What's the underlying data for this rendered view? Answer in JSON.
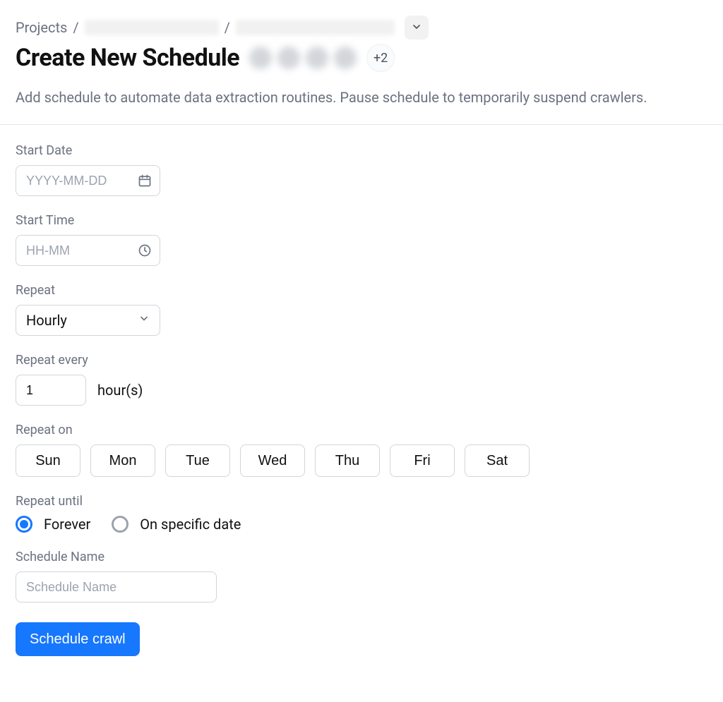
{
  "breadcrumb": {
    "root": "Projects",
    "sep": "/",
    "extra_badge": "+2"
  },
  "header": {
    "title": "Create New Schedule",
    "subtitle": "Add schedule to automate data extraction routines. Pause schedule to temporarily suspend crawlers."
  },
  "form": {
    "start_date": {
      "label": "Start Date",
      "placeholder": "YYYY-MM-DD",
      "value": ""
    },
    "start_time": {
      "label": "Start Time",
      "placeholder": "HH-MM",
      "value": ""
    },
    "repeat": {
      "label": "Repeat",
      "selected": "Hourly"
    },
    "repeat_every": {
      "label": "Repeat every",
      "value": "1",
      "unit": "hour(s)"
    },
    "repeat_on": {
      "label": "Repeat on",
      "days": [
        "Sun",
        "Mon",
        "Tue",
        "Wed",
        "Thu",
        "Fri",
        "Sat"
      ]
    },
    "repeat_until": {
      "label": "Repeat until",
      "options": {
        "forever": "Forever",
        "specific": "On specific date"
      },
      "selected": "forever"
    },
    "schedule_name": {
      "label": "Schedule Name",
      "placeholder": "Schedule Name",
      "value": ""
    },
    "submit_label": "Schedule crawl"
  }
}
